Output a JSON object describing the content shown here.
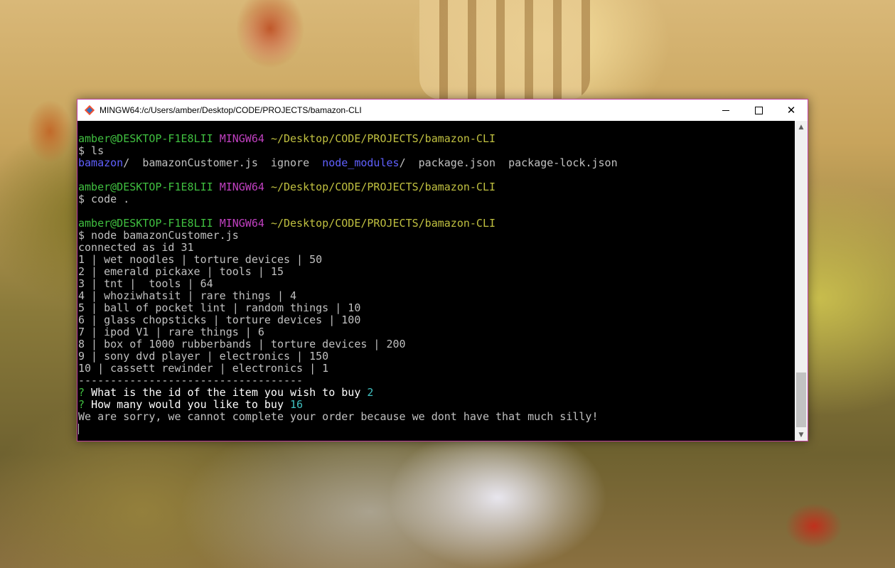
{
  "window": {
    "title": "MINGW64:/c/Users/amber/Desktop/CODE/PROJECTS/bamazon-CLI",
    "icon": "git-bash-icon",
    "controls": {
      "minimize": "—",
      "maximize": "☐",
      "close": "✕"
    }
  },
  "terminal": {
    "prompt": {
      "user_host": "amber@DESKTOP-F1E8LII",
      "shell": "MINGW64",
      "path": "~/Desktop/CODE/PROJECTS/bamazon-CLI"
    },
    "commands": {
      "ls": "$ ls",
      "code": "$ code .",
      "node": "$ node bamazonCustomer.js"
    },
    "ls_output": {
      "dir1": "bamazon",
      "sep1": "/  ",
      "file1": "bamazonCustomer.js  ignore  ",
      "dir2": "node_modules",
      "sep2": "/  ",
      "file2": "package.json  package-lock.json"
    },
    "output_lines": [
      "connected as id 31",
      "1 | wet noodles | torture devices | 50",
      "2 | emerald pickaxe | tools | 15",
      "3 | tnt |  tools | 64",
      "4 | whoziwhatsit | rare things | 4",
      "5 | ball of pocket lint | random things | 10",
      "6 | glass chopsticks | torture devices | 100",
      "7 | ipod V1 | rare things | 6",
      "8 | box of 1000 rubberbands | torture devices | 200",
      "9 | sony dvd player | electronics | 150",
      "10 | cassett rewinder | electronics | 1",
      "-----------------------------------"
    ],
    "questions": [
      {
        "mark": "? ",
        "text": "What is the id of the item you wish to buy ",
        "answer": "2"
      },
      {
        "mark": "? ",
        "text": "How many would you like to buy ",
        "answer": "16"
      }
    ],
    "message": "We are sorry, we cannot complete your order because we dont have that much silly!"
  },
  "scrollbar": {
    "up": "▲",
    "down": "▼"
  },
  "colors": {
    "prompt_user": "#40c040",
    "prompt_shell": "#c040c0",
    "prompt_path": "#c0c040",
    "directory": "#6060ff",
    "answer": "#40c0c0",
    "window_border": "#c040a0"
  }
}
